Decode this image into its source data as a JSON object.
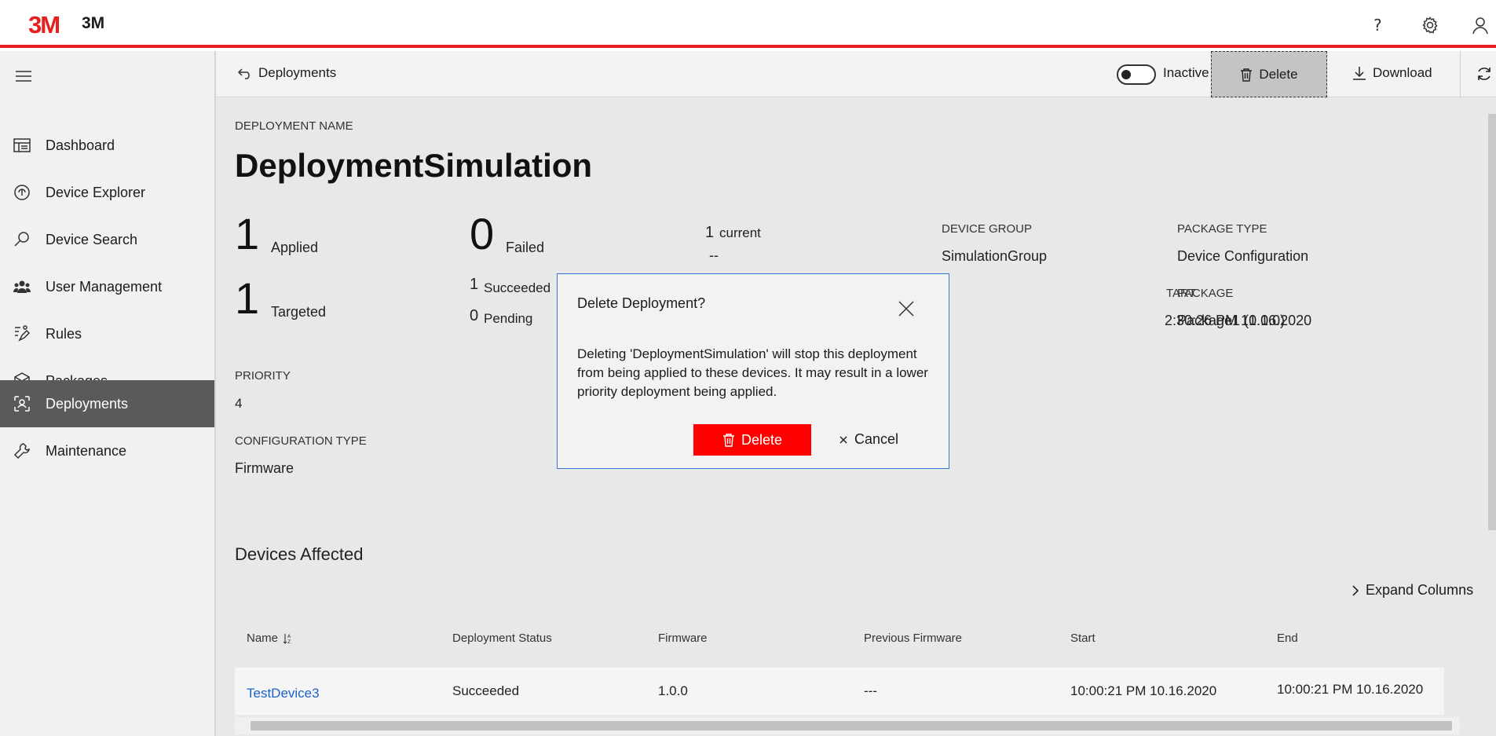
{
  "header": {
    "logo_text": "3M",
    "brand": "3M",
    "icons": [
      "help-icon",
      "settings-icon",
      "user-icon"
    ],
    "accent_color": "#e8201d"
  },
  "sidebar": {
    "items": [
      {
        "label": "Dashboard",
        "icon": "dashboard-icon"
      },
      {
        "label": "Device Explorer",
        "icon": "device-explorer-icon"
      },
      {
        "label": "Device Search",
        "icon": "search-icon"
      },
      {
        "label": "User Management",
        "icon": "users-icon"
      },
      {
        "label": "Rules",
        "icon": "rules-icon"
      },
      {
        "label": "Packages",
        "icon": "package-icon"
      },
      {
        "label": "Deployments",
        "icon": "deployments-icon",
        "active": true
      },
      {
        "label": "Maintenance",
        "icon": "maintenance-icon"
      }
    ]
  },
  "commandbar": {
    "back_label": "Deployments",
    "toggle_label": "Inactive",
    "delete_label": "Delete",
    "download_label": "Download"
  },
  "deployment": {
    "name_label": "DEPLOYMENT NAME",
    "name": "DeploymentSimulation",
    "applied_count": "1",
    "applied_label": "Applied",
    "targeted_count": "1",
    "targeted_label": "Targeted",
    "failed_count": "0",
    "failed_label": "Failed",
    "succeeded_count": "1",
    "succeeded_label": "Succeeded",
    "pending_count": "0",
    "pending_label": "Pending",
    "current_count": "1",
    "current_label": "current",
    "current_value": "--",
    "device_group_label": "DEVICE GROUP",
    "device_group": "SimulationGroup",
    "start_label": "TART",
    "start": "2:30:26 PM 10.16.2020",
    "package_type_label": "PACKAGE TYPE",
    "package_type": "Device Configuration",
    "package_label": "PACKAGE",
    "package": "Package1 (1.0.0)",
    "priority_label": "PRIORITY",
    "priority": "4",
    "config_type_label": "CONFIGURATION TYPE",
    "config_type": "Firmware"
  },
  "devices": {
    "title": "Devices Affected",
    "expand_label": "Expand Columns",
    "columns": [
      "Name",
      "Deployment Status",
      "Firmware",
      "Previous Firmware",
      "Start",
      "End"
    ],
    "rows": [
      {
        "name": "TestDevice3",
        "status": "Succeeded",
        "firmware": "1.0.0",
        "previous": "---",
        "start": "10:00:21 PM 10.16.2020",
        "end": "10:00:21 PM 10.16.2020"
      }
    ]
  },
  "dialog": {
    "title": "Delete Deployment?",
    "body": "Deleting 'DeploymentSimulation' will stop this deployment from being applied to these devices. It may result in a lower priority deployment being applied.",
    "delete_label": "Delete",
    "cancel_label": "Cancel",
    "delete_color": "#ff0000"
  }
}
